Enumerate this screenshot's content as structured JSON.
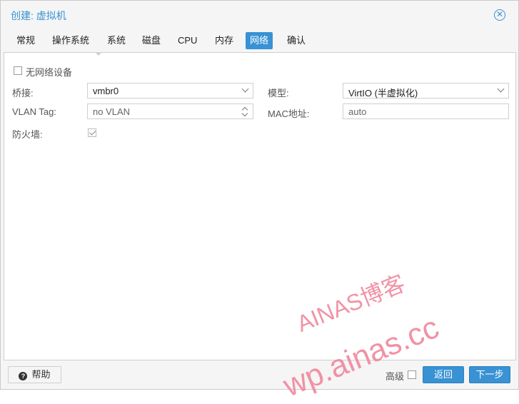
{
  "dialog": {
    "title": "创建: 虚拟机"
  },
  "tabs": [
    {
      "label": "常规"
    },
    {
      "label": "操作系统"
    },
    {
      "label": "系统"
    },
    {
      "label": "磁盘"
    },
    {
      "label": "CPU"
    },
    {
      "label": "内存"
    },
    {
      "label": "网络",
      "active": true
    },
    {
      "label": "确认"
    }
  ],
  "form": {
    "no_network_label": "无网络设备",
    "no_network_checked": false,
    "bridge_label": "桥接:",
    "bridge_value": "vmbr0",
    "vlan_label": "VLAN Tag:",
    "vlan_value": "no VLAN",
    "firewall_label": "防火墙:",
    "firewall_checked": true,
    "model_label": "模型:",
    "model_value": "VirtIO (半虚拟化)",
    "mac_label": "MAC地址:",
    "mac_value": "auto"
  },
  "footer": {
    "help_label": "帮助",
    "advanced_label": "高级",
    "advanced_checked": false,
    "back_label": "返回",
    "next_label": "下一步"
  },
  "watermark": {
    "line1": "AINAS博客",
    "line2": "wp.ainas.cc"
  },
  "colors": {
    "accent": "#3892d4",
    "watermark": "#f08a9e"
  },
  "icons": {
    "close": "close-circle-icon",
    "help": "question-circle-icon"
  }
}
